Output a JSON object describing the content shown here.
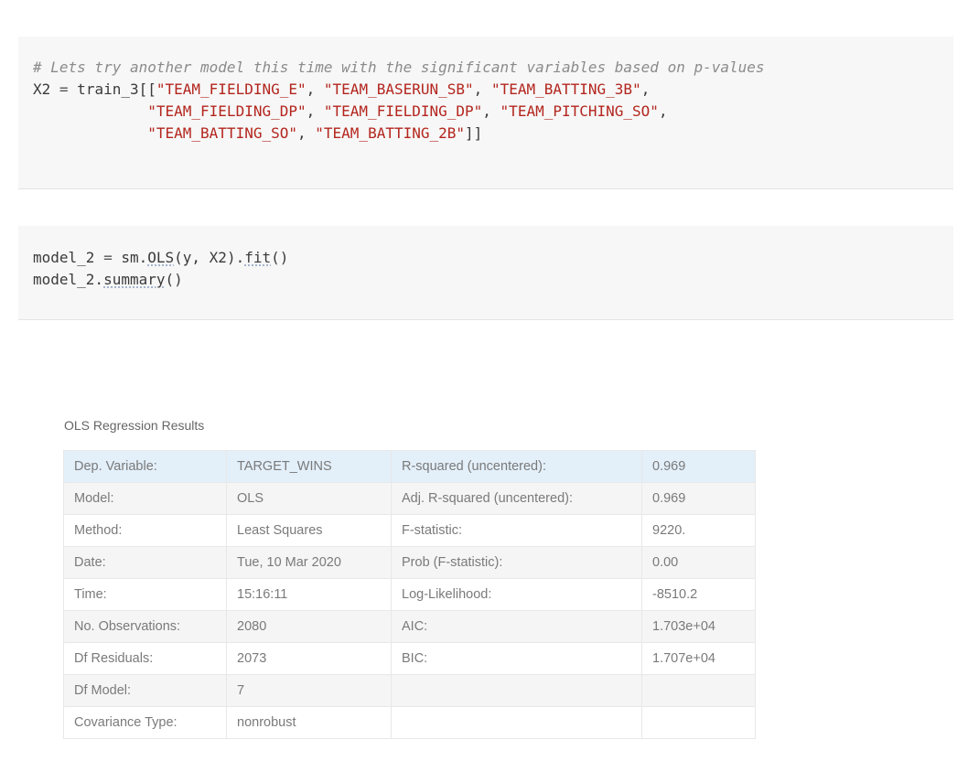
{
  "cells": [
    {
      "lines": [
        [
          {
            "t": "# Lets try another model this time with the significant variables based on p-values",
            "c": "cm"
          }
        ],
        [
          {
            "t": "X2 ",
            "c": ""
          },
          {
            "t": "=",
            "c": "op"
          },
          {
            "t": " train_3[[",
            "c": ""
          },
          {
            "t": "\"TEAM_FIELDING_E\"",
            "c": "str"
          },
          {
            "t": ", ",
            "c": ""
          },
          {
            "t": "\"TEAM_BASERUN_SB\"",
            "c": "str"
          },
          {
            "t": ", ",
            "c": ""
          },
          {
            "t": "\"TEAM_BATTING_3B\"",
            "c": "str"
          },
          {
            "t": ",",
            "c": ""
          }
        ],
        [
          {
            "t": "             ",
            "c": ""
          },
          {
            "t": "\"TEAM_FIELDING_DP\"",
            "c": "str"
          },
          {
            "t": ", ",
            "c": ""
          },
          {
            "t": "\"TEAM_FIELDING_DP\"",
            "c": "str"
          },
          {
            "t": ", ",
            "c": ""
          },
          {
            "t": "\"TEAM_PITCHING_SO\"",
            "c": "str"
          },
          {
            "t": ",",
            "c": ""
          }
        ],
        [
          {
            "t": "             ",
            "c": ""
          },
          {
            "t": "\"TEAM_BATTING_SO\"",
            "c": "str"
          },
          {
            "t": ", ",
            "c": ""
          },
          {
            "t": "\"TEAM_BATTING_2B\"",
            "c": "str"
          },
          {
            "t": "]]",
            "c": ""
          }
        ]
      ]
    },
    {
      "lines": [
        [
          {
            "t": "model_2 ",
            "c": ""
          },
          {
            "t": "=",
            "c": "op"
          },
          {
            "t": " sm.",
            "c": ""
          },
          {
            "t": "OLS",
            "c": "ul"
          },
          {
            "t": "(y, X2).",
            "c": ""
          },
          {
            "t": "fit",
            "c": "ul"
          },
          {
            "t": "()",
            "c": ""
          }
        ],
        [
          {
            "t": "model_2.",
            "c": ""
          },
          {
            "t": "summary",
            "c": "ul"
          },
          {
            "t": "()",
            "c": ""
          }
        ]
      ]
    }
  ],
  "results": {
    "caption": "OLS Regression Results",
    "rows": [
      [
        "Dep. Variable:",
        "TARGET_WINS",
        "R-squared (uncentered):",
        "0.969"
      ],
      [
        "Model:",
        "OLS",
        "Adj. R-squared (uncentered):",
        "0.969"
      ],
      [
        "Method:",
        "Least Squares",
        "F-statistic:",
        "9220."
      ],
      [
        "Date:",
        "Tue, 10 Mar 2020",
        "Prob (F-statistic):",
        "0.00"
      ],
      [
        "Time:",
        "15:16:11",
        "Log-Likelihood:",
        "-8510.2"
      ],
      [
        "No. Observations:",
        "2080",
        "AIC:",
        "1.703e+04"
      ],
      [
        "Df Residuals:",
        "2073",
        "BIC:",
        "1.707e+04"
      ],
      [
        "Df Model:",
        "7",
        "",
        ""
      ],
      [
        "Covariance Type:",
        "nonrobust",
        "",
        ""
      ]
    ]
  }
}
